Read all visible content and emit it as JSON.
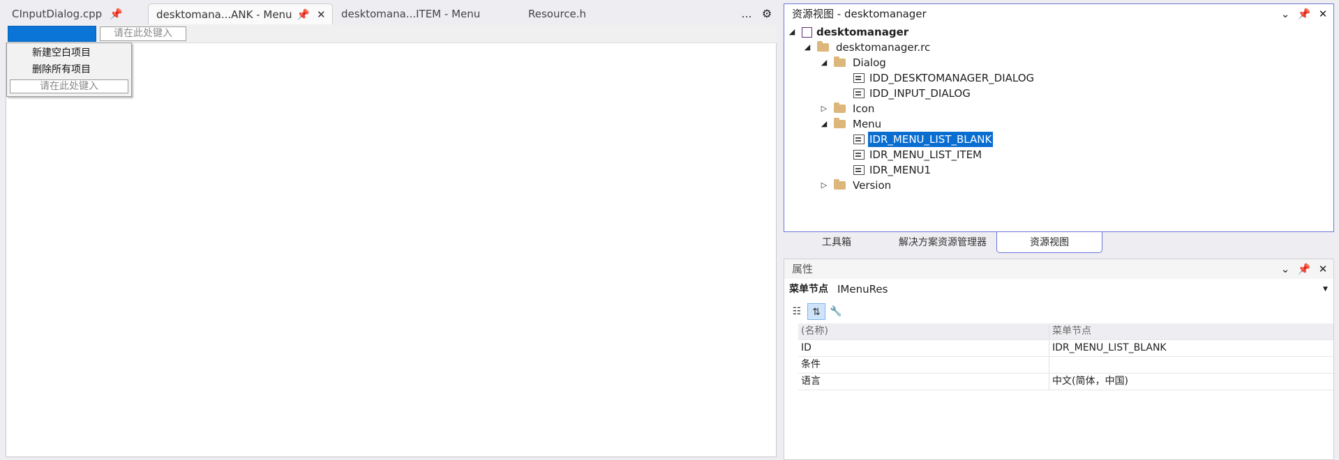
{
  "editor": {
    "tabs": [
      {
        "label": "CInputDialog.cpp",
        "pinned": true,
        "active": false
      },
      {
        "label": "desktomana...ANK - Menu",
        "pinned": true,
        "active": true
      },
      {
        "label": "desktomana...ITEM - Menu",
        "active": false
      },
      {
        "label": "Resource.h",
        "active": false
      }
    ],
    "overflow_icon": "…",
    "settings_icon": "⚙",
    "menubar": {
      "type_here_placeholder": "请在此处键入"
    },
    "dropdown": {
      "items": [
        "新建空白项目",
        "删除所有项目"
      ],
      "type_here_placeholder": "请在此处键入"
    }
  },
  "resource_view": {
    "title": "资源视图 - desktomanager",
    "tree": [
      {
        "label": "desktomanager",
        "level": 0,
        "expanded": true,
        "bold": true,
        "icon": "project-icon"
      },
      {
        "label": "desktomanager.rc",
        "level": 1,
        "expanded": true,
        "icon": "folder-open-icon"
      },
      {
        "label": "Dialog",
        "level": 2,
        "expanded": true,
        "icon": "folder-open-icon"
      },
      {
        "label": "IDD_DESKTOMANAGER_DIALOG",
        "level": 3,
        "icon": "dialog-resource-icon"
      },
      {
        "label": "IDD_INPUT_DIALOG",
        "level": 3,
        "icon": "dialog-resource-icon"
      },
      {
        "label": "Icon",
        "level": 2,
        "expanded": false,
        "icon": "folder-icon"
      },
      {
        "label": "Menu",
        "level": 2,
        "expanded": true,
        "icon": "folder-open-icon"
      },
      {
        "label": "IDR_MENU_LIST_BLANK",
        "level": 3,
        "icon": "menu-resource-icon",
        "selected": true
      },
      {
        "label": "IDR_MENU_LIST_ITEM",
        "level": 3,
        "icon": "menu-resource-icon"
      },
      {
        "label": "IDR_MENU1",
        "level": 3,
        "icon": "menu-resource-icon"
      },
      {
        "label": "Version",
        "level": 2,
        "expanded": false,
        "icon": "folder-icon"
      }
    ]
  },
  "bottom_tabs": [
    {
      "label": "工具箱",
      "active": false
    },
    {
      "label": "解决方案资源管理器",
      "active": false
    },
    {
      "label": "资源视图",
      "active": true
    }
  ],
  "properties": {
    "title": "属性",
    "object_type": "菜单节点",
    "object_name": "IMenuRes",
    "grid": [
      {
        "name": "(名称)",
        "value": "菜单节点",
        "category": true
      },
      {
        "name": "ID",
        "value": "IDR_MENU_LIST_BLANK"
      },
      {
        "name": "条件",
        "value": ""
      },
      {
        "name": "语言",
        "value": "中文(简体，中国)"
      }
    ]
  },
  "colors": {
    "accent": "#0a74d7",
    "panel_border": "#6b77d8",
    "folder": "#dcb67a"
  }
}
